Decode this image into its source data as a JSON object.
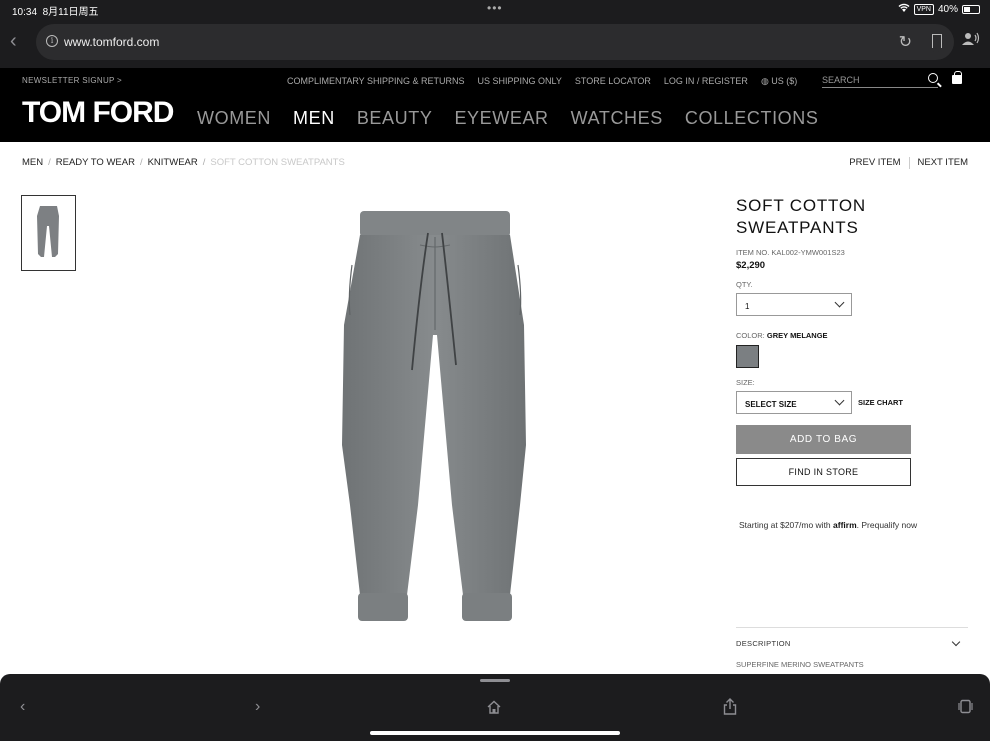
{
  "status_bar": {
    "time": "10:34",
    "date": "8月11日周五",
    "vpn": "VPN",
    "battery": "40%"
  },
  "browser": {
    "url": "www.tomford.com"
  },
  "site_header": {
    "newsletter": "NEWSLETTER SIGNUP >",
    "utility_links": [
      "COMPLIMENTARY SHIPPING & RETURNS",
      "US SHIPPING ONLY",
      "STORE LOCATOR",
      "LOG IN / REGISTER",
      "◍ US ($)"
    ],
    "search_placeholder": "SEARCH",
    "logo": "TOM FORD",
    "nav": [
      "WOMEN",
      "MEN",
      "BEAUTY",
      "EYEWEAR",
      "WATCHES",
      "COLLECTIONS"
    ],
    "active_nav": "MEN"
  },
  "breadcrumb": [
    "MEN",
    "READY TO WEAR",
    "KNITWEAR",
    "SOFT COTTON SWEATPANTS"
  ],
  "pager": {
    "prev": "PREV ITEM",
    "next": "NEXT ITEM"
  },
  "product": {
    "title_line1": "SOFT COTTON",
    "title_line2": "SWEATPANTS",
    "item_no": "ITEM NO. KAL002-YMW001S23",
    "price": "$2,290",
    "qty_label": "QTY.",
    "qty_value": "1",
    "color_label": "COLOR:",
    "color_value": "GREY MELANGE",
    "swatch_color": "#7b7f82",
    "size_label": "SIZE:",
    "size_value": "SELECT SIZE",
    "size_chart": "SIZE CHART",
    "add_to_bag": "ADD TO BAG",
    "find_in_store": "FIND IN STORE",
    "affirm_pre": "Starting at $207/mo with ",
    "affirm_brand": "affirm",
    "affirm_post": ". Prequalify now",
    "description_label": "DESCRIPTION",
    "description_text": "SUPERFINE MERINO SWEATPANTS"
  },
  "colors": {
    "header_bg": "#000000",
    "add_to_bag_bg": "#8a8a8a",
    "chrome_bg": "#1c1c1e"
  }
}
